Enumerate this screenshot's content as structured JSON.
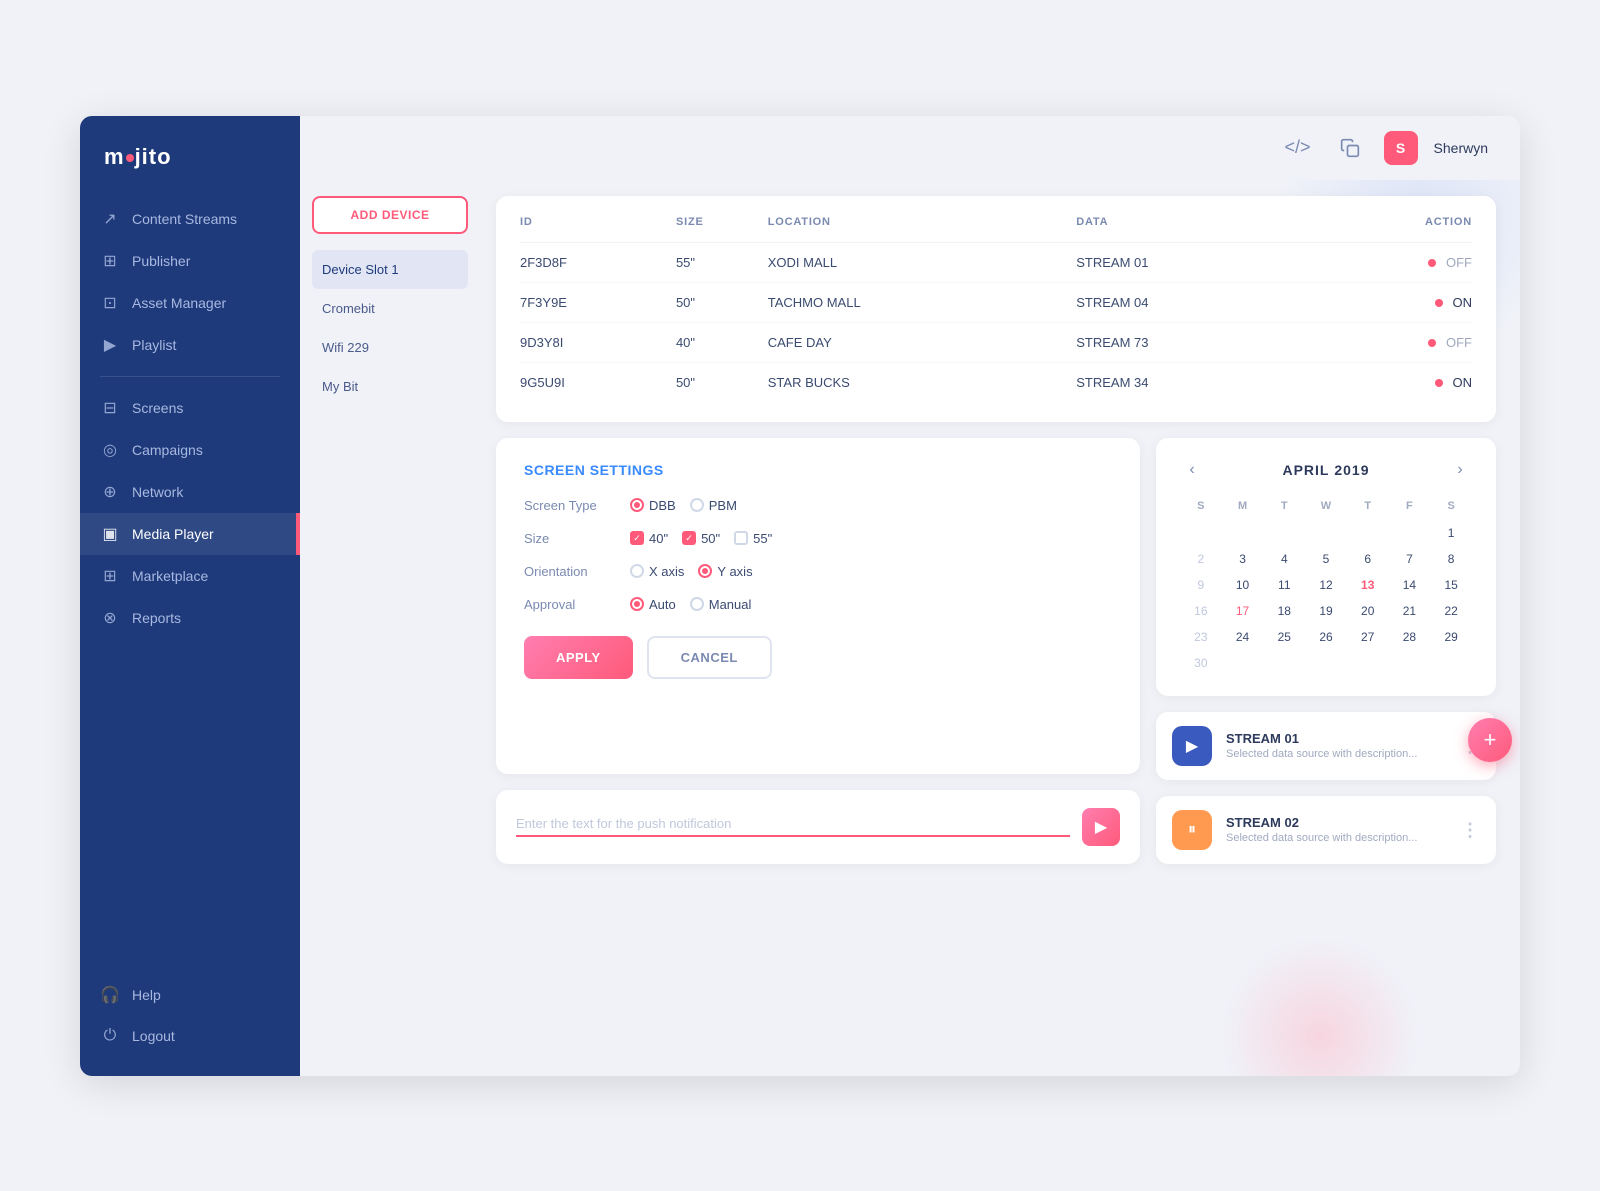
{
  "app": {
    "title": "Mojito",
    "logo_text_1": "m",
    "logo_text_2": "jit",
    "logo_text_3": "o"
  },
  "topbar": {
    "code_icon": "</>",
    "copy_icon": "⧉",
    "username": "Sherwyn",
    "avatar_letter": "S"
  },
  "sidebar": {
    "items": [
      {
        "id": "content-streams",
        "label": "Content Streams",
        "icon": "↗",
        "active": false
      },
      {
        "id": "publisher",
        "label": "Publisher",
        "icon": "⊞",
        "active": false
      },
      {
        "id": "asset-manager",
        "label": "Asset Manager",
        "icon": "⊡",
        "active": false
      },
      {
        "id": "playlist",
        "label": "Playlist",
        "icon": "▶",
        "active": false
      },
      {
        "id": "screens",
        "label": "Screens",
        "icon": "⊟",
        "active": false
      },
      {
        "id": "campaigns",
        "label": "Campaigns",
        "icon": "◎",
        "active": false
      },
      {
        "id": "network",
        "label": "Network",
        "icon": "⊕",
        "active": false
      },
      {
        "id": "media-player",
        "label": "Media Player",
        "icon": "▣",
        "active": true
      },
      {
        "id": "marketplace",
        "label": "Marketplace",
        "icon": "⊞",
        "active": false
      },
      {
        "id": "reports",
        "label": "Reports",
        "icon": "⊗",
        "active": false
      }
    ],
    "bottom": [
      {
        "id": "help",
        "label": "Help",
        "icon": "🎧"
      },
      {
        "id": "logout",
        "label": "Logout",
        "icon": "⏻"
      }
    ]
  },
  "devices": {
    "add_btn": "ADD DEVICE",
    "items": [
      {
        "label": "Device Slot 1",
        "active": true
      },
      {
        "label": "Cromebit",
        "active": false
      },
      {
        "label": "Wifi 229",
        "active": false
      },
      {
        "label": "My Bit",
        "active": false
      }
    ]
  },
  "table": {
    "headers": [
      "ID",
      "SIZE",
      "LOCATION",
      "DATA",
      "ACTION"
    ],
    "rows": [
      {
        "id": "2F3D8F",
        "size": "55\"",
        "location": "XODI MALL",
        "data": "STREAM 01",
        "status": "OFF"
      },
      {
        "id": "7F3Y9E",
        "size": "50\"",
        "location": "TACHMO MALL",
        "data": "STREAM 04",
        "status": "ON"
      },
      {
        "id": "9D3Y8I",
        "size": "40\"",
        "location": "CAFE DAY",
        "data": "STREAM 73",
        "status": "OFF"
      },
      {
        "id": "9G5U9I",
        "size": "50\"",
        "location": "STAR BUCKS",
        "data": "STREAM 34",
        "status": "ON"
      }
    ]
  },
  "screen_settings": {
    "title": "SCREEN SETTINGS",
    "fields": [
      {
        "label": "Screen Type",
        "options": [
          {
            "type": "radio",
            "label": "DBB",
            "checked": true
          },
          {
            "type": "radio",
            "label": "PBM",
            "checked": false
          }
        ]
      },
      {
        "label": "Size",
        "options": [
          {
            "type": "checkbox",
            "label": "40\"",
            "checked": true
          },
          {
            "type": "checkbox",
            "label": "50\"",
            "checked": true
          },
          {
            "type": "checkbox",
            "label": "55\"",
            "checked": false
          }
        ]
      },
      {
        "label": "Orientation",
        "options": [
          {
            "type": "radio",
            "label": "X axis",
            "checked": false
          },
          {
            "type": "radio",
            "label": "Y axis",
            "checked": true
          }
        ]
      },
      {
        "label": "Approval",
        "options": [
          {
            "type": "radio",
            "label": "Auto",
            "checked": true
          },
          {
            "type": "radio",
            "label": "Manual",
            "checked": false
          }
        ]
      }
    ],
    "apply_label": "APPLY",
    "cancel_label": "CANCEL"
  },
  "calendar": {
    "month": "APRIL",
    "year": "2019",
    "days_of_week": [
      "S",
      "M",
      "T",
      "W",
      "T",
      "F",
      "S"
    ],
    "weeks": [
      [
        "",
        "",
        "",
        "",
        "",
        "",
        "1"
      ],
      [
        "2",
        "3",
        "4",
        "5",
        "6",
        "7",
        "8"
      ],
      [
        "9",
        "10",
        "11",
        "12",
        "13",
        "14",
        "15"
      ],
      [
        "16",
        "17",
        "18",
        "19",
        "20",
        "21",
        "22"
      ],
      [
        "23",
        "24",
        "25",
        "26",
        "27",
        "28",
        "29"
      ],
      [
        "30",
        "",
        "",
        "",
        "",
        "",
        ""
      ]
    ],
    "today": "13",
    "highlighted": "17"
  },
  "streams": [
    {
      "id": "stream-01",
      "name": "STREAM 01",
      "desc": "Selected data source with description...",
      "icon": "▶",
      "icon_type": "play"
    },
    {
      "id": "stream-02",
      "name": "STREAM 02",
      "desc": "Selected data source with description...",
      "icon": "⏸",
      "icon_type": "pause"
    }
  ],
  "notification": {
    "placeholder": "Enter the text for the push notification",
    "send_icon": "▶"
  }
}
